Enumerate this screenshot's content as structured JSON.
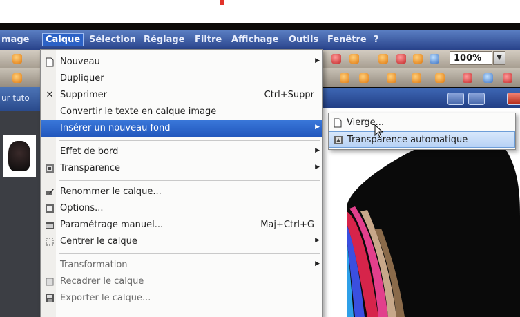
{
  "menubar": {
    "items": [
      {
        "label": "mage"
      },
      {
        "label": "Calque"
      },
      {
        "label": "Sélection"
      },
      {
        "label": "Réglage"
      },
      {
        "label": "Filtre"
      },
      {
        "label": "Affichage"
      },
      {
        "label": "Outils"
      },
      {
        "label": "Fenêtre"
      },
      {
        "label": "?"
      }
    ],
    "active_index": 1
  },
  "toolbar": {
    "zoom_value": "100%"
  },
  "left_panel": {
    "title": "ur tuto"
  },
  "layer_menu": {
    "items": [
      {
        "label": "Nouveau",
        "icon": "new-page-icon",
        "submenu": true
      },
      {
        "label": "Dupliquer"
      },
      {
        "label": "Supprimer",
        "icon": "close-x-icon",
        "shortcut": "Ctrl+Suppr"
      },
      {
        "label": "Convertir le texte en calque image"
      },
      {
        "label": "Insérer un nouveau fond",
        "submenu": true,
        "highlighted": true
      },
      {
        "label": "Effet de bord",
        "submenu": true
      },
      {
        "label": "Transparence",
        "icon": "transparency-icon",
        "submenu": true
      },
      {
        "label": "Renommer le calque...",
        "icon": "rename-pencil-icon"
      },
      {
        "label": "Options...",
        "icon": "options-icon"
      },
      {
        "label": "Paramétrage manuel...",
        "icon": "manual-settings-icon",
        "shortcut": "Maj+Ctrl+G"
      },
      {
        "label": "Centrer le calque",
        "icon": "center-icon",
        "submenu": true
      },
      {
        "label": "Transformation",
        "submenu": true,
        "dimmed": true
      },
      {
        "label": "Recadrer le calque",
        "icon": "crop-icon",
        "dimmed": true
      },
      {
        "label": "Exporter le calque...",
        "icon": "save-disk-icon",
        "dimmed": true
      }
    ]
  },
  "background_submenu": {
    "items": [
      {
        "label": "Vierge...",
        "icon": "blank-page-icon"
      },
      {
        "label": "Transparence automatique",
        "icon": "auto-transparency-icon",
        "highlighted": true
      }
    ]
  },
  "colors": {
    "menubar": "#28428a",
    "highlight": "#2257bd",
    "submenu_highlight": "#b7d2f5"
  }
}
